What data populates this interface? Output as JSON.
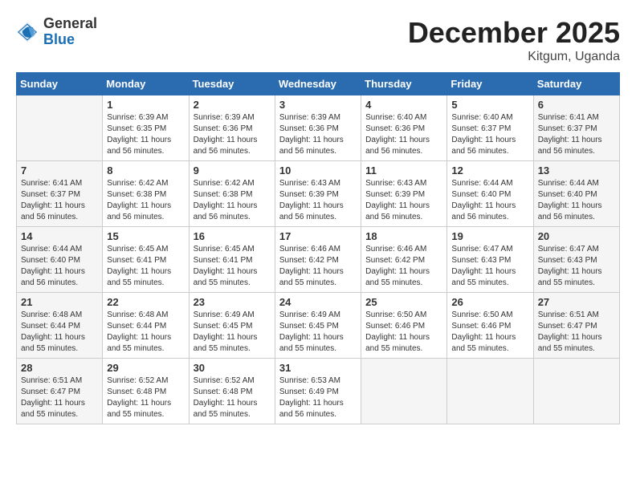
{
  "header": {
    "logo": {
      "general": "General",
      "blue": "Blue"
    },
    "title": "December 2025",
    "location": "Kitgum, Uganda"
  },
  "calendar": {
    "columns": [
      "Sunday",
      "Monday",
      "Tuesday",
      "Wednesday",
      "Thursday",
      "Friday",
      "Saturday"
    ],
    "weeks": [
      [
        {
          "day": "",
          "empty": true
        },
        {
          "day": "1",
          "sunrise": "6:39 AM",
          "sunset": "6:35 PM",
          "daylight": "11 hours and 56 minutes."
        },
        {
          "day": "2",
          "sunrise": "6:39 AM",
          "sunset": "6:36 PM",
          "daylight": "11 hours and 56 minutes."
        },
        {
          "day": "3",
          "sunrise": "6:39 AM",
          "sunset": "6:36 PM",
          "daylight": "11 hours and 56 minutes."
        },
        {
          "day": "4",
          "sunrise": "6:40 AM",
          "sunset": "6:36 PM",
          "daylight": "11 hours and 56 minutes."
        },
        {
          "day": "5",
          "sunrise": "6:40 AM",
          "sunset": "6:37 PM",
          "daylight": "11 hours and 56 minutes."
        },
        {
          "day": "6",
          "sunrise": "6:41 AM",
          "sunset": "6:37 PM",
          "daylight": "11 hours and 56 minutes."
        }
      ],
      [
        {
          "day": "7",
          "sunrise": "6:41 AM",
          "sunset": "6:37 PM",
          "daylight": "11 hours and 56 minutes."
        },
        {
          "day": "8",
          "sunrise": "6:42 AM",
          "sunset": "6:38 PM",
          "daylight": "11 hours and 56 minutes."
        },
        {
          "day": "9",
          "sunrise": "6:42 AM",
          "sunset": "6:38 PM",
          "daylight": "11 hours and 56 minutes."
        },
        {
          "day": "10",
          "sunrise": "6:43 AM",
          "sunset": "6:39 PM",
          "daylight": "11 hours and 56 minutes."
        },
        {
          "day": "11",
          "sunrise": "6:43 AM",
          "sunset": "6:39 PM",
          "daylight": "11 hours and 56 minutes."
        },
        {
          "day": "12",
          "sunrise": "6:44 AM",
          "sunset": "6:40 PM",
          "daylight": "11 hours and 56 minutes."
        },
        {
          "day": "13",
          "sunrise": "6:44 AM",
          "sunset": "6:40 PM",
          "daylight": "11 hours and 56 minutes."
        }
      ],
      [
        {
          "day": "14",
          "sunrise": "6:44 AM",
          "sunset": "6:40 PM",
          "daylight": "11 hours and 56 minutes."
        },
        {
          "day": "15",
          "sunrise": "6:45 AM",
          "sunset": "6:41 PM",
          "daylight": "11 hours and 55 minutes."
        },
        {
          "day": "16",
          "sunrise": "6:45 AM",
          "sunset": "6:41 PM",
          "daylight": "11 hours and 55 minutes."
        },
        {
          "day": "17",
          "sunrise": "6:46 AM",
          "sunset": "6:42 PM",
          "daylight": "11 hours and 55 minutes."
        },
        {
          "day": "18",
          "sunrise": "6:46 AM",
          "sunset": "6:42 PM",
          "daylight": "11 hours and 55 minutes."
        },
        {
          "day": "19",
          "sunrise": "6:47 AM",
          "sunset": "6:43 PM",
          "daylight": "11 hours and 55 minutes."
        },
        {
          "day": "20",
          "sunrise": "6:47 AM",
          "sunset": "6:43 PM",
          "daylight": "11 hours and 55 minutes."
        }
      ],
      [
        {
          "day": "21",
          "sunrise": "6:48 AM",
          "sunset": "6:44 PM",
          "daylight": "11 hours and 55 minutes."
        },
        {
          "day": "22",
          "sunrise": "6:48 AM",
          "sunset": "6:44 PM",
          "daylight": "11 hours and 55 minutes."
        },
        {
          "day": "23",
          "sunrise": "6:49 AM",
          "sunset": "6:45 PM",
          "daylight": "11 hours and 55 minutes."
        },
        {
          "day": "24",
          "sunrise": "6:49 AM",
          "sunset": "6:45 PM",
          "daylight": "11 hours and 55 minutes."
        },
        {
          "day": "25",
          "sunrise": "6:50 AM",
          "sunset": "6:46 PM",
          "daylight": "11 hours and 55 minutes."
        },
        {
          "day": "26",
          "sunrise": "6:50 AM",
          "sunset": "6:46 PM",
          "daylight": "11 hours and 55 minutes."
        },
        {
          "day": "27",
          "sunrise": "6:51 AM",
          "sunset": "6:47 PM",
          "daylight": "11 hours and 55 minutes."
        }
      ],
      [
        {
          "day": "28",
          "sunrise": "6:51 AM",
          "sunset": "6:47 PM",
          "daylight": "11 hours and 55 minutes."
        },
        {
          "day": "29",
          "sunrise": "6:52 AM",
          "sunset": "6:48 PM",
          "daylight": "11 hours and 55 minutes."
        },
        {
          "day": "30",
          "sunrise": "6:52 AM",
          "sunset": "6:48 PM",
          "daylight": "11 hours and 55 minutes."
        },
        {
          "day": "31",
          "sunrise": "6:53 AM",
          "sunset": "6:49 PM",
          "daylight": "11 hours and 56 minutes."
        },
        {
          "day": "",
          "empty": true
        },
        {
          "day": "",
          "empty": true
        },
        {
          "day": "",
          "empty": true
        }
      ]
    ]
  }
}
